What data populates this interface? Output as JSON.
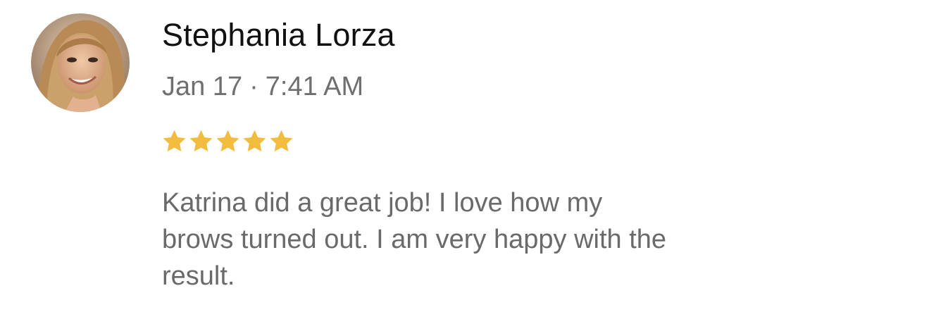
{
  "review": {
    "author": "Stephania Lorza",
    "date": "Jan 17",
    "separator": "·",
    "time": "7:41 AM",
    "rating": 5,
    "rating_max": 5,
    "star_color": "#F2BD3E",
    "text": "Katrina did a great job! I love how my\nbrows turned out. I am very happy with the\nresult.",
    "avatar_icon": "profile-photo"
  }
}
